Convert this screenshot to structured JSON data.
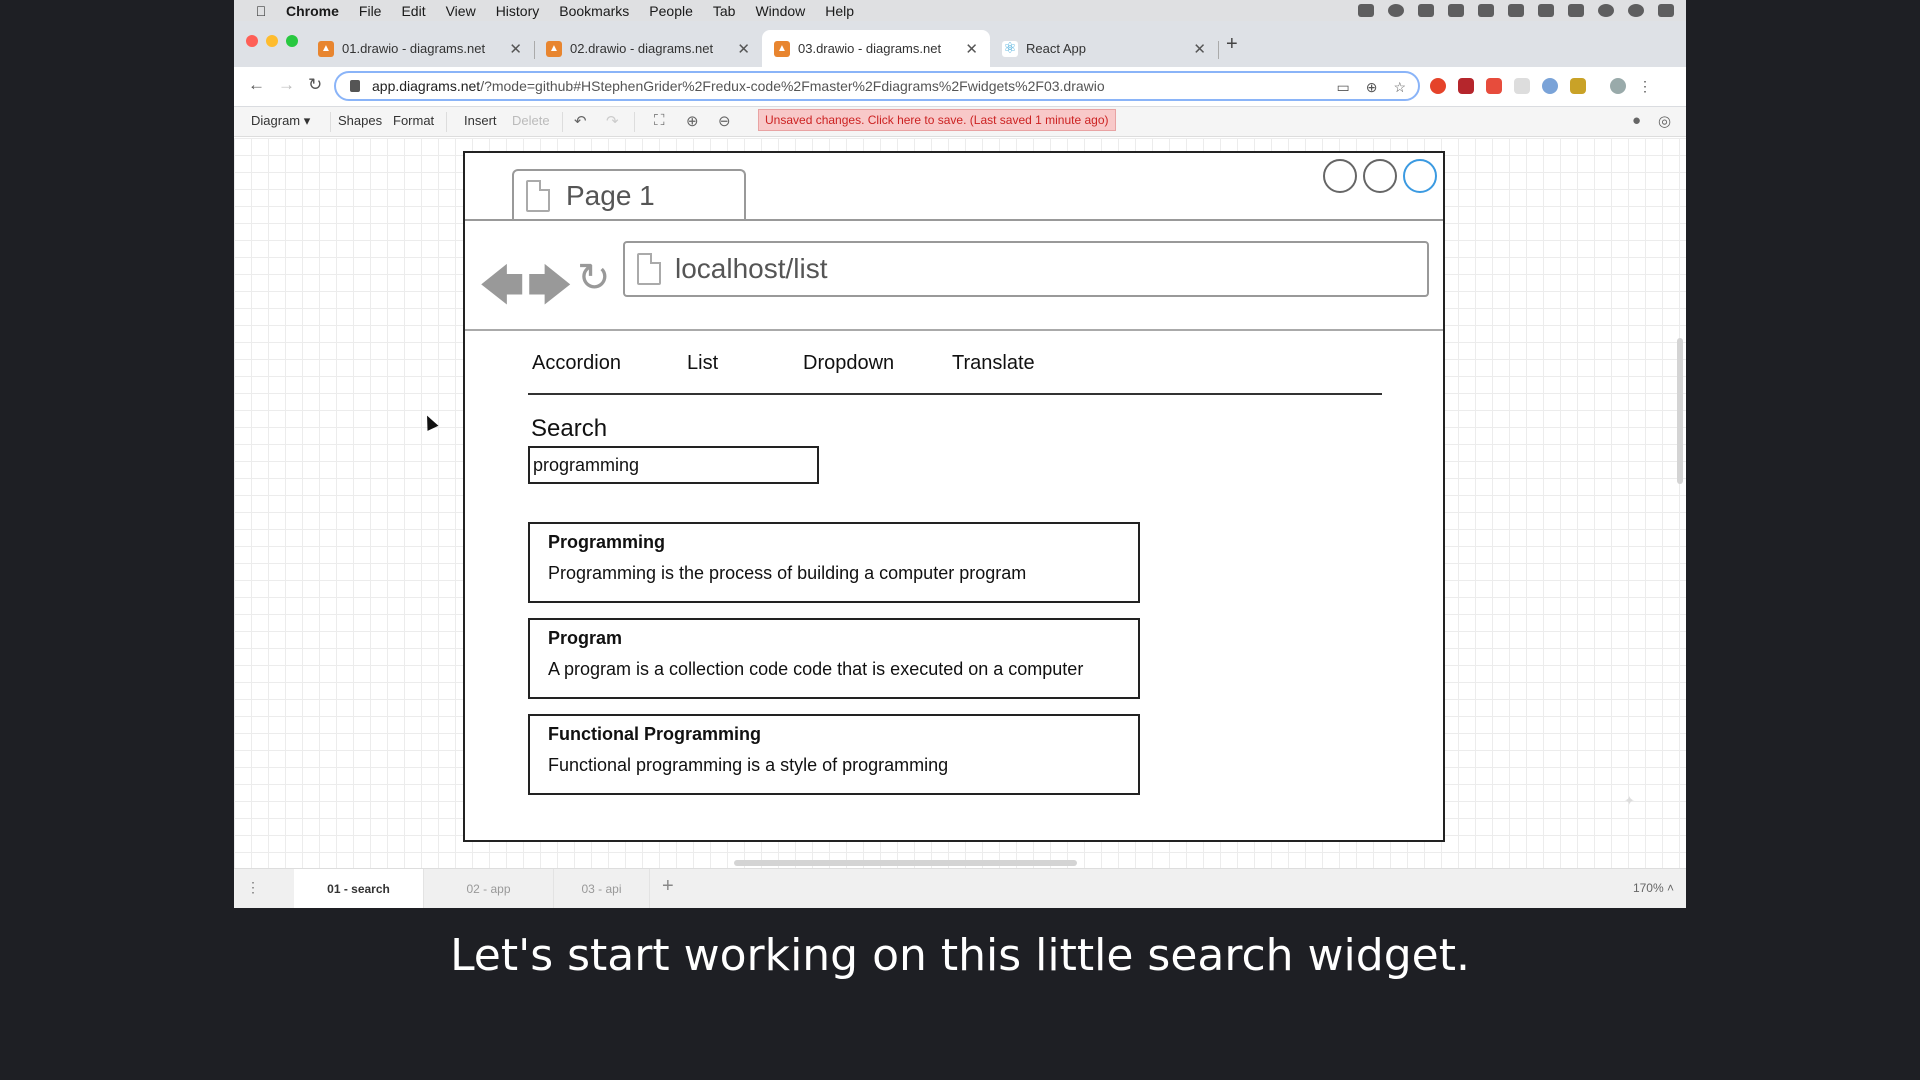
{
  "menubar": {
    "app": "Chrome",
    "items": [
      "File",
      "Edit",
      "View",
      "History",
      "Bookmarks",
      "People",
      "Tab",
      "Window",
      "Help"
    ]
  },
  "tabs": [
    {
      "label": "01.drawio - diagrams.net",
      "icon": "drawio-icon"
    },
    {
      "label": "02.drawio - diagrams.net",
      "icon": "drawio-icon"
    },
    {
      "label": "03.drawio - diagrams.net",
      "icon": "drawio-icon",
      "active": true
    },
    {
      "label": "React App",
      "icon": "react-icon"
    }
  ],
  "address": {
    "host": "app.diagrams.net",
    "path": "/?mode=github#HStephenGrider%2Fredux-code%2Fmaster%2Fdiagrams%2Fwidgets%2F03.drawio"
  },
  "drawio_toolbar": {
    "diagram": "Diagram",
    "shapes": "Shapes",
    "format": "Format",
    "insert": "Insert",
    "delete": "Delete",
    "unsaved": "Unsaved changes. Click here to save. (Last saved 1 minute ago)"
  },
  "mockup": {
    "page_tab": "Page 1",
    "url": "localhost/list",
    "nav": [
      "Accordion",
      "List",
      "Dropdown",
      "Translate"
    ],
    "search_label": "Search",
    "search_value": "programming",
    "results": [
      {
        "title": "Programming",
        "desc": "Programming is the process of building a computer program"
      },
      {
        "title": "Program",
        "desc": "A program is a collection code code that is executed on a computer"
      },
      {
        "title": "Functional Programming",
        "desc": "Functional programming is a style of programming"
      }
    ]
  },
  "pages": {
    "items": [
      "01 - search",
      "02 - app",
      "03 - api"
    ],
    "zoom": "170%"
  },
  "caption": "Let's start working on this little search widget.",
  "colors": {
    "unsaved_bg": "#f8c9c9",
    "selection_blue": "#3b9ae1",
    "drawio_orange": "#e8852f"
  }
}
